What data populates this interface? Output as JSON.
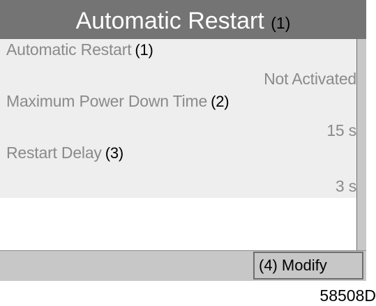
{
  "header": {
    "title": "Automatic Restart",
    "callout": "(1)"
  },
  "settings": {
    "items": [
      {
        "label": "Automatic Restart",
        "callout": "(1)",
        "value": "Not Activated"
      },
      {
        "label": "Maximum Power Down Time",
        "callout": "(2)",
        "value": "15 s"
      },
      {
        "label": "Restart Delay",
        "callout": "(3)",
        "value": "3 s"
      }
    ]
  },
  "footer": {
    "modify_callout": "(4)",
    "modify_label": "Modify"
  },
  "figure_id": "58508D",
  "colors": {
    "title_bar": "#747474",
    "footer_bar": "#c7c7c7",
    "shaded_row": "#eeeeee",
    "text_gray": "#8a8a8a"
  }
}
